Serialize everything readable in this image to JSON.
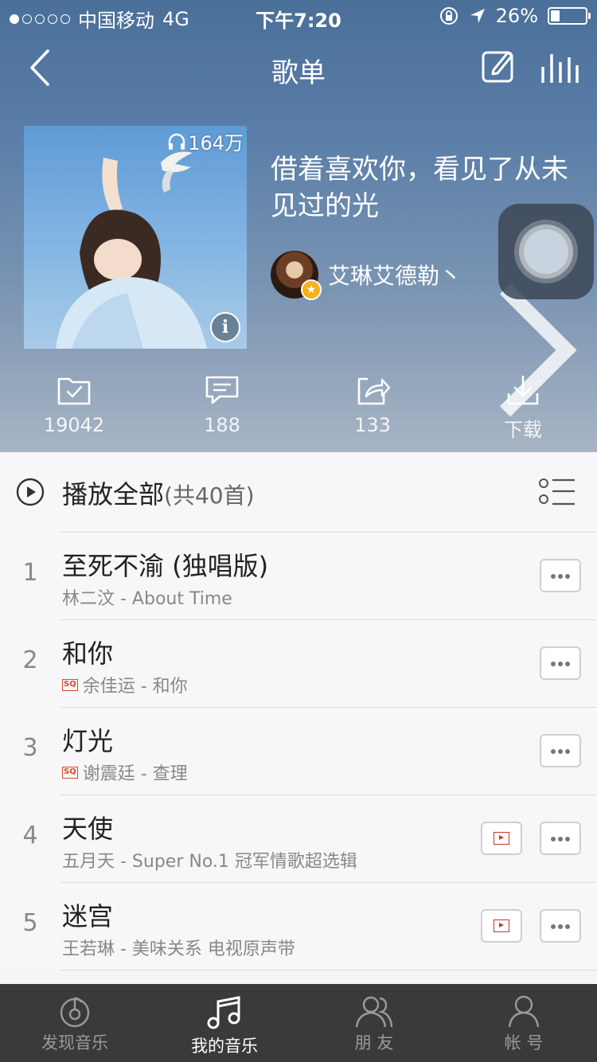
{
  "status": {
    "carrier": "中国移动",
    "network": "4G",
    "time": "下午7:20",
    "battery": "26%",
    "battery_level": 0.26
  },
  "nav": {
    "title": "歌单"
  },
  "playlist": {
    "play_count": "164万",
    "title": "借着喜欢你，看见了从未见过的光",
    "creator": "艾琳艾德勒丶"
  },
  "actions": [
    {
      "icon": "collect-folder-icon",
      "count": "19042"
    },
    {
      "icon": "comment-icon",
      "count": "188"
    },
    {
      "icon": "share-icon",
      "count": "133"
    },
    {
      "icon": "download-icon",
      "count": "下载"
    }
  ],
  "list": {
    "play_all_label": "播放全部",
    "play_all_count": "(共40首)",
    "songs": [
      {
        "index": "1",
        "title": "至死不渝 (独唱版)",
        "meta": "林二汶 - About Time",
        "sq": false,
        "mv": false
      },
      {
        "index": "2",
        "title": "和你",
        "meta": "余佳运 - 和你",
        "sq": true,
        "mv": false
      },
      {
        "index": "3",
        "title": "灯光",
        "meta": "谢震廷 - 查理",
        "sq": true,
        "mv": false
      },
      {
        "index": "4",
        "title": "天使",
        "meta": "五月天 - Super No.1 冠军情歌超选辑",
        "sq": false,
        "mv": true
      },
      {
        "index": "5",
        "title": "迷宫",
        "meta": "王若琳 - 美味关系 电视原声带",
        "sq": false,
        "mv": true
      }
    ],
    "sq_badge": "SQ"
  },
  "tabbar": [
    {
      "label": "发现音乐",
      "icon": "discover-music-icon",
      "active": false
    },
    {
      "label": "我的音乐",
      "icon": "my-music-icon",
      "active": true
    },
    {
      "label": "朋 友",
      "icon": "friends-icon",
      "active": false
    },
    {
      "label": "帐 号",
      "icon": "account-icon",
      "active": false
    }
  ],
  "colors": {
    "hero_top": "#4a6f98",
    "hero_bottom": "#a8b5c4",
    "tabbar": "#3a3a3d",
    "sq_badge": "#d84c2a",
    "mv_icon": "#c0392b"
  }
}
